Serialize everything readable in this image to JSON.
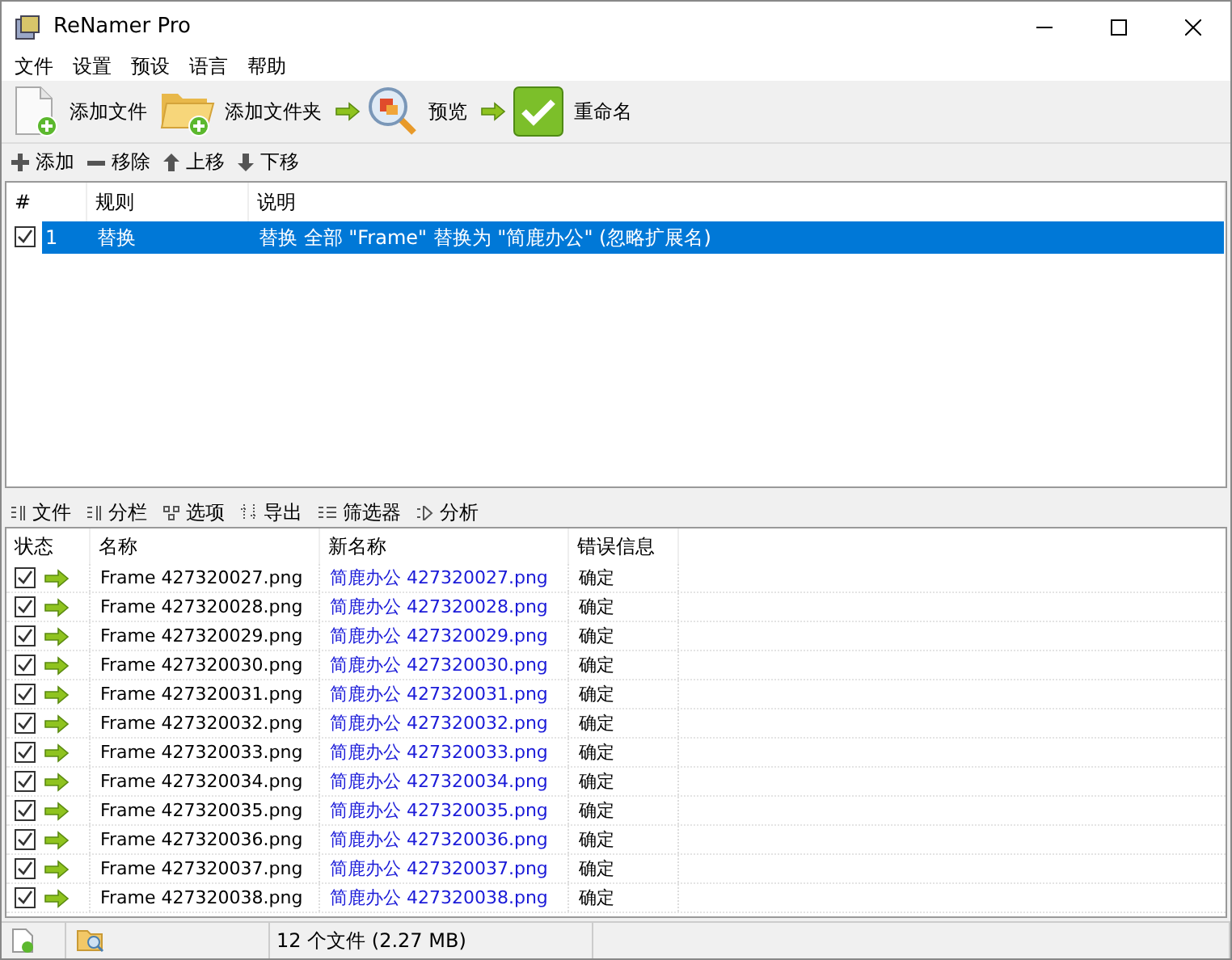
{
  "window": {
    "title": "ReNamer Pro"
  },
  "menu": [
    "文件",
    "设置",
    "预设",
    "语言",
    "帮助"
  ],
  "toolbar": [
    {
      "kind": "add-file",
      "label": "添加文件"
    },
    {
      "kind": "add-folder",
      "label": "添加文件夹"
    },
    {
      "kind": "preview",
      "label": "预览"
    },
    {
      "kind": "rename",
      "label": "重命名"
    }
  ],
  "rule_toolbar": [
    {
      "kind": "add",
      "label": "添加"
    },
    {
      "kind": "remove",
      "label": "移除"
    },
    {
      "kind": "up",
      "label": "上移"
    },
    {
      "kind": "down",
      "label": "下移"
    }
  ],
  "rules": {
    "columns": [
      "#",
      "规则",
      "说明"
    ],
    "rows": [
      {
        "checked": true,
        "selected": true,
        "index": "1",
        "rule": "替换",
        "description": "替换 全部 \"Frame\" 替换为 \"简鹿办公\" (忽略扩展名)"
      }
    ]
  },
  "file_toolbar": [
    {
      "kind": "files",
      "label": "文件"
    },
    {
      "kind": "columns",
      "label": "分栏"
    },
    {
      "kind": "options",
      "label": "选项"
    },
    {
      "kind": "export",
      "label": "导出"
    },
    {
      "kind": "filter",
      "label": "筛选器"
    },
    {
      "kind": "analyze",
      "label": "分析"
    }
  ],
  "files": {
    "columns": [
      "状态",
      "名称",
      "新名称",
      "错误信息"
    ],
    "rows": [
      {
        "checked": true,
        "name": "Frame 427320027.png",
        "new_name": "简鹿办公 427320027.png",
        "error": "确定"
      },
      {
        "checked": true,
        "name": "Frame 427320028.png",
        "new_name": "简鹿办公 427320028.png",
        "error": "确定"
      },
      {
        "checked": true,
        "name": "Frame 427320029.png",
        "new_name": "简鹿办公 427320029.png",
        "error": "确定"
      },
      {
        "checked": true,
        "name": "Frame 427320030.png",
        "new_name": "简鹿办公 427320030.png",
        "error": "确定"
      },
      {
        "checked": true,
        "name": "Frame 427320031.png",
        "new_name": "简鹿办公 427320031.png",
        "error": "确定"
      },
      {
        "checked": true,
        "name": "Frame 427320032.png",
        "new_name": "简鹿办公 427320032.png",
        "error": "确定"
      },
      {
        "checked": true,
        "name": "Frame 427320033.png",
        "new_name": "简鹿办公 427320033.png",
        "error": "确定"
      },
      {
        "checked": true,
        "name": "Frame 427320034.png",
        "new_name": "简鹿办公 427320034.png",
        "error": "确定"
      },
      {
        "checked": true,
        "name": "Frame 427320035.png",
        "new_name": "简鹿办公 427320035.png",
        "error": "确定"
      },
      {
        "checked": true,
        "name": "Frame 427320036.png",
        "new_name": "简鹿办公 427320036.png",
        "error": "确定"
      },
      {
        "checked": true,
        "name": "Frame 427320037.png",
        "new_name": "简鹿办公 427320037.png",
        "error": "确定"
      },
      {
        "checked": true,
        "name": "Frame 427320038.png",
        "new_name": "简鹿办公 427320038.png",
        "error": "确定"
      }
    ]
  },
  "status_bar": {
    "file_count": "12 个文件 (2.27 MB)"
  }
}
